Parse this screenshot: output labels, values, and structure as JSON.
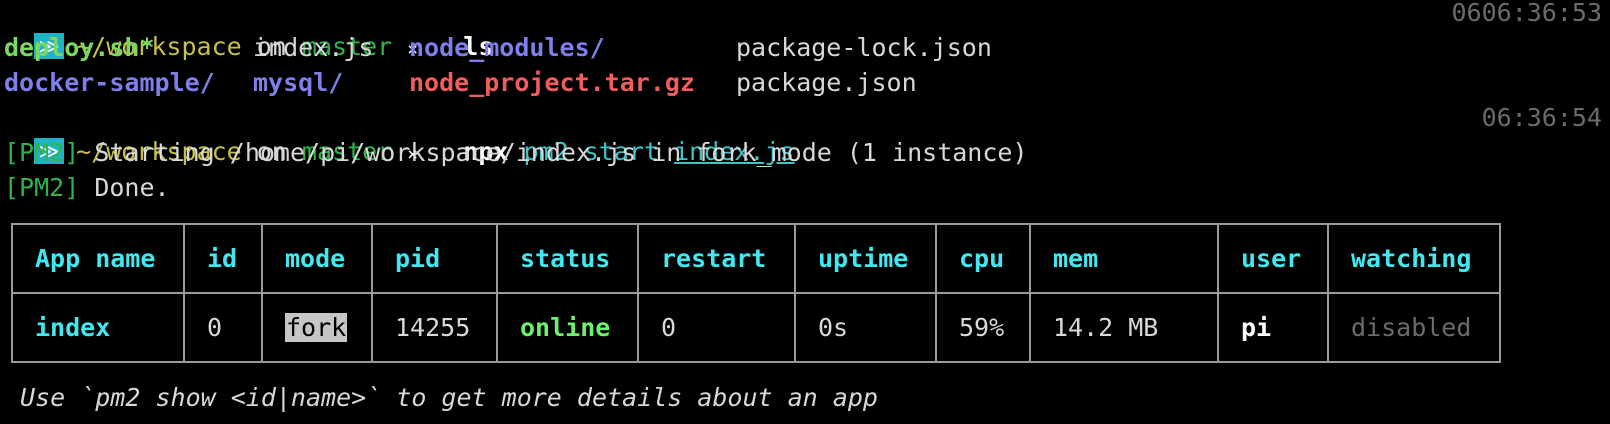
{
  "prompt_badge": "≫",
  "prompt1": {
    "path": "~/workspace",
    "on": "on",
    "branch": "master",
    "dirty": "×",
    "command": "ls",
    "time": "0606:36:53"
  },
  "ls": {
    "row1": [
      "deploy.sh*",
      "index.js",
      "node_modules/",
      "package-lock.json"
    ],
    "row2": [
      "docker-sample/",
      "mysql/",
      "node_project.tar.gz",
      "package.json"
    ]
  },
  "prompt2": {
    "path": "~/workspace",
    "on": "on",
    "branch": "master",
    "dirty": "×",
    "cmd_npx": "npx",
    "cmd_pm2": "pm2",
    "cmd_start": "start",
    "cmd_file": "index.js",
    "time": "06:36:54"
  },
  "pm2_output": {
    "tag": "[PM2]",
    "line1": " Starting /home/pi/workspace/index.js in fork_mode (1 instance)",
    "line2": " Done."
  },
  "table": {
    "headers": [
      "App name",
      "id",
      "mode",
      "pid",
      "status",
      "restart",
      "uptime",
      "cpu",
      "mem",
      "user",
      "watching"
    ],
    "row": {
      "app_name": "index",
      "id": "0",
      "mode": "fork",
      "pid": "14255",
      "status": "online",
      "restart": "0",
      "uptime": "0s",
      "cpu": "59%",
      "mem": "14.2 MB",
      "user": "pi",
      "watching": "disabled"
    }
  },
  "hint": "Use `pm2 show <id|name>` to get more details about an app",
  "colors": {
    "badge_bg": "#1fb3c4",
    "table_header": "#42e8ef",
    "status_online": "#6df06d"
  }
}
